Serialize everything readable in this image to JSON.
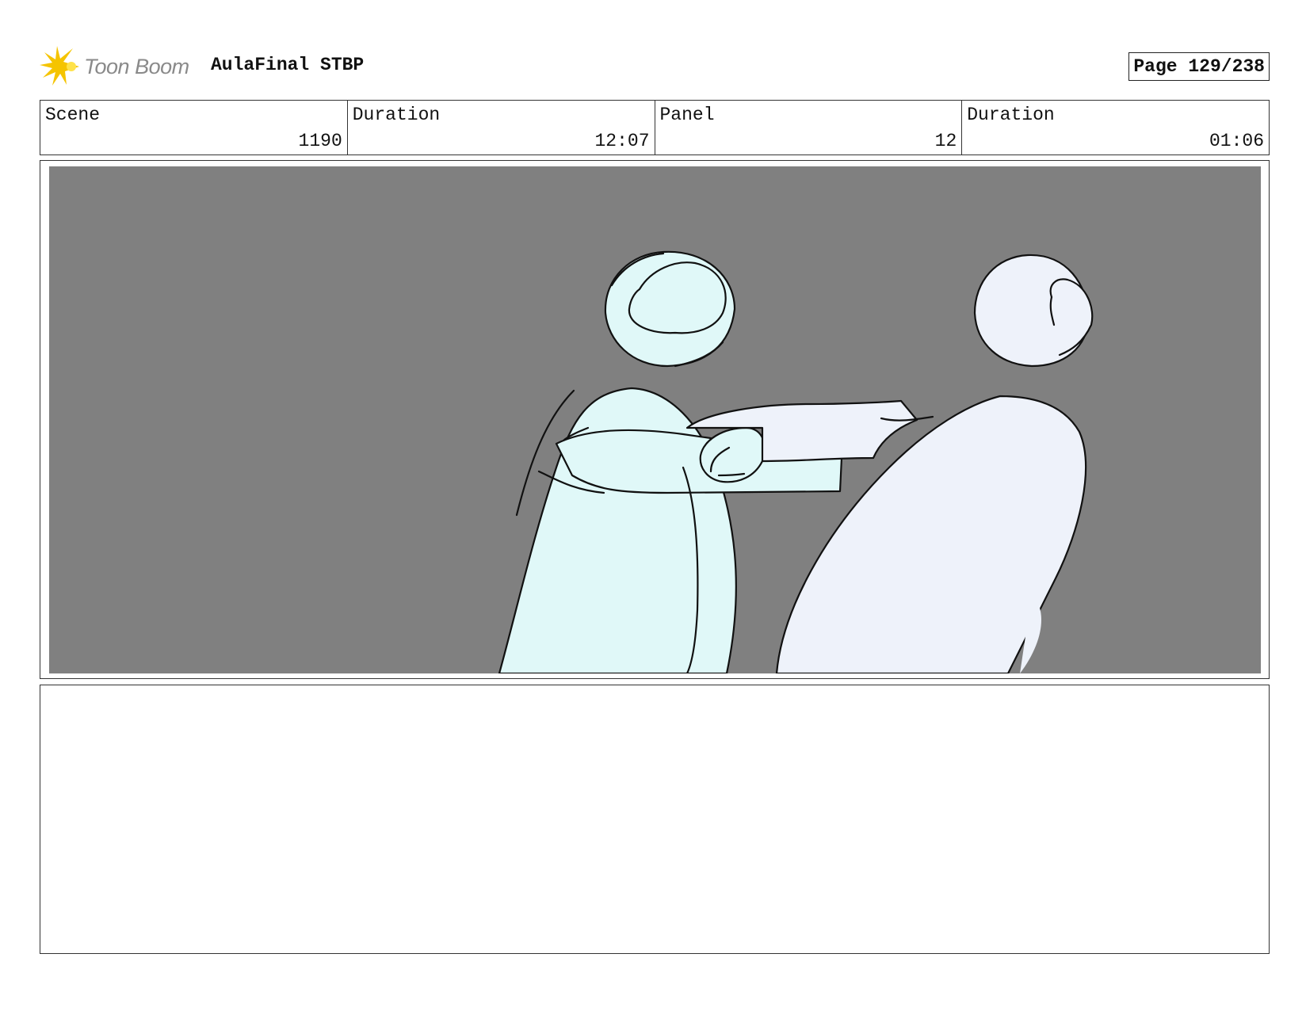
{
  "header": {
    "logo_text": "Toon Boom",
    "project_title": "AulaFinal STBP",
    "page_label": "Page 129/238"
  },
  "info": [
    {
      "label": "Scene",
      "value": "1190"
    },
    {
      "label": "Duration",
      "value": "12:07"
    },
    {
      "label": "Panel",
      "value": "12"
    },
    {
      "label": "Duration",
      "value": "01:06"
    }
  ],
  "panel": {
    "background_color": "#808080",
    "character_left_color": "#e0f8f8",
    "character_right_color": "#eef2fa"
  },
  "notes": {
    "text": ""
  }
}
